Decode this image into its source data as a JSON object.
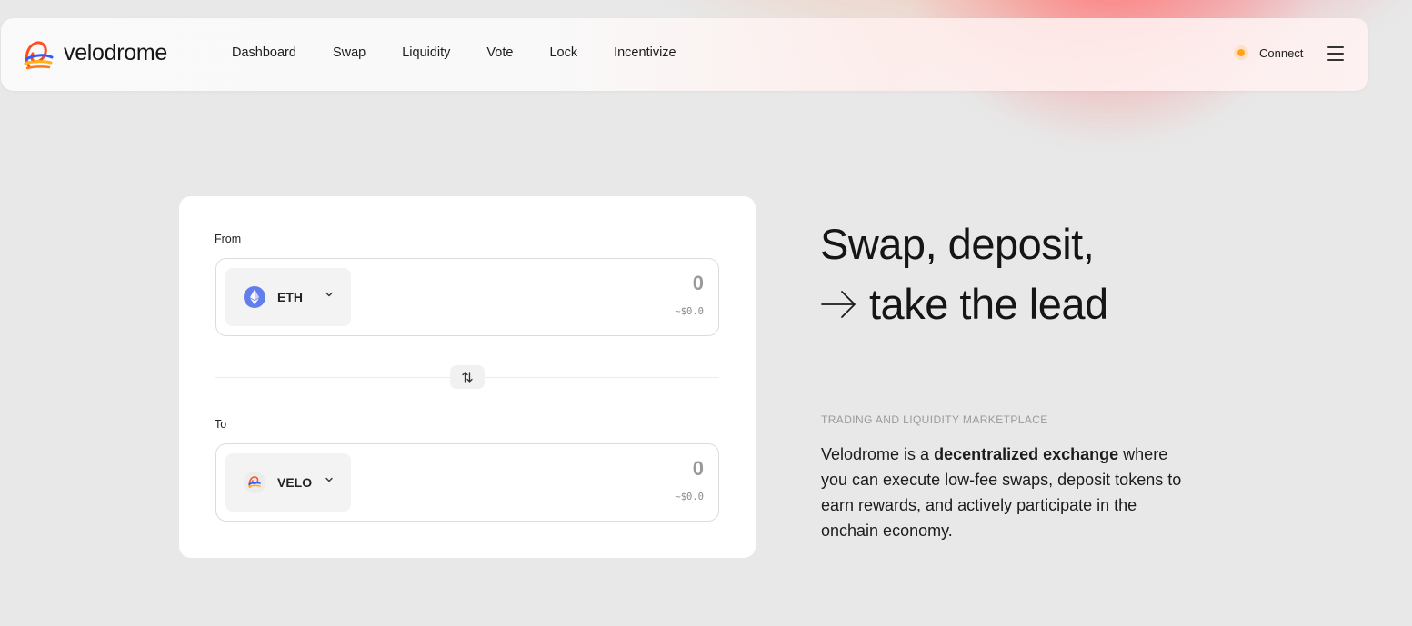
{
  "brand": {
    "name": "velodrome"
  },
  "nav": {
    "links": [
      "Dashboard",
      "Swap",
      "Liquidity",
      "Vote",
      "Lock",
      "Incentivize"
    ],
    "connect_label": "Connect",
    "connect_status_color": "#ffa31a"
  },
  "swap": {
    "from": {
      "label": "From",
      "token": "ETH",
      "amount_placeholder": "0",
      "usd_value": "~$0.0"
    },
    "to": {
      "label": "To",
      "token": "VELO",
      "amount_placeholder": "0",
      "usd_value": "~$0.0"
    }
  },
  "hero": {
    "title_line1": "Swap, deposit,",
    "title_line2": "take the lead",
    "tagline": "TRADING AND LIQUIDITY MARKETPLACE",
    "desc_before": "Velodrome is a ",
    "desc_bold": "decentralized exchange",
    "desc_after": " where you can execute low-fee swaps, deposit tokens to earn rewards, and actively participate in the onchain economy."
  },
  "icons": {
    "eth": "ethereum-icon",
    "velo": "velodrome-token-icon",
    "swap_direction": "swap-arrows-icon",
    "menu": "hamburger-menu-icon"
  },
  "colors": {
    "eth": "#627eea",
    "connect_dot": "#ffa31a",
    "background": "#e8e8e8"
  }
}
